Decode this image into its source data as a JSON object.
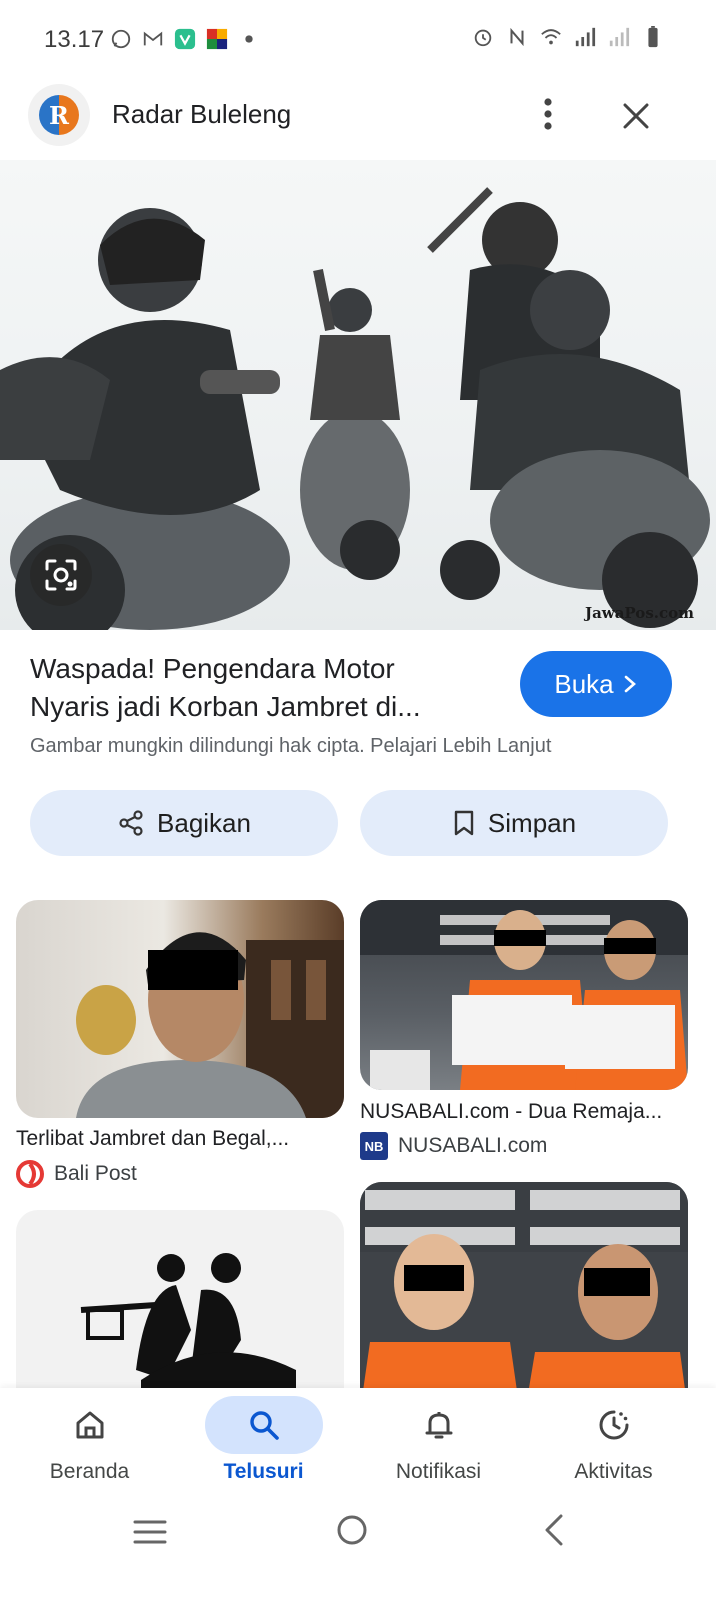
{
  "status_bar": {
    "time": "13.17",
    "left_icons": [
      "whatsapp-icon",
      "gmail-icon",
      "vpn-app-icon",
      "grid-app-icon",
      "dot-icon"
    ],
    "right_icons": [
      "alarm-icon",
      "nfc-icon",
      "wifi-icon",
      "signal-icon",
      "signal-2-icon",
      "battery-icon"
    ]
  },
  "header": {
    "site_name": "Radar Buleleng",
    "logo_letter": "R"
  },
  "hero": {
    "watermark": "JawaPos.com"
  },
  "article": {
    "title": "Waspada! Pengendara Motor Nyaris jadi Korban Jambret di...",
    "open_label": "Buka",
    "copyright_note": "Gambar mungkin dilindungi hak cipta. Pelajari Lebih Lanjut"
  },
  "actions": {
    "share_label": "Bagikan",
    "save_label": "Simpan"
  },
  "results": [
    {
      "title": "Terlibat Jambret dan Begal,...",
      "source": "Bali Post"
    },
    {
      "title": "NUSABALI.com - Dua Remaja...",
      "source": "NUSABALI.com",
      "badge": "NB"
    }
  ],
  "nav": {
    "items": [
      {
        "label": "Beranda",
        "icon": "home-icon"
      },
      {
        "label": "Telusuri",
        "icon": "search-icon",
        "active": true
      },
      {
        "label": "Notifikasi",
        "icon": "bell-icon"
      },
      {
        "label": "Aktivitas",
        "icon": "activity-icon"
      }
    ]
  },
  "colors": {
    "accent": "#1a73e8",
    "pill_bg": "#e3ecfa",
    "nav_active_bg": "#d3e3fd",
    "nav_active_text": "#0b57d0"
  }
}
